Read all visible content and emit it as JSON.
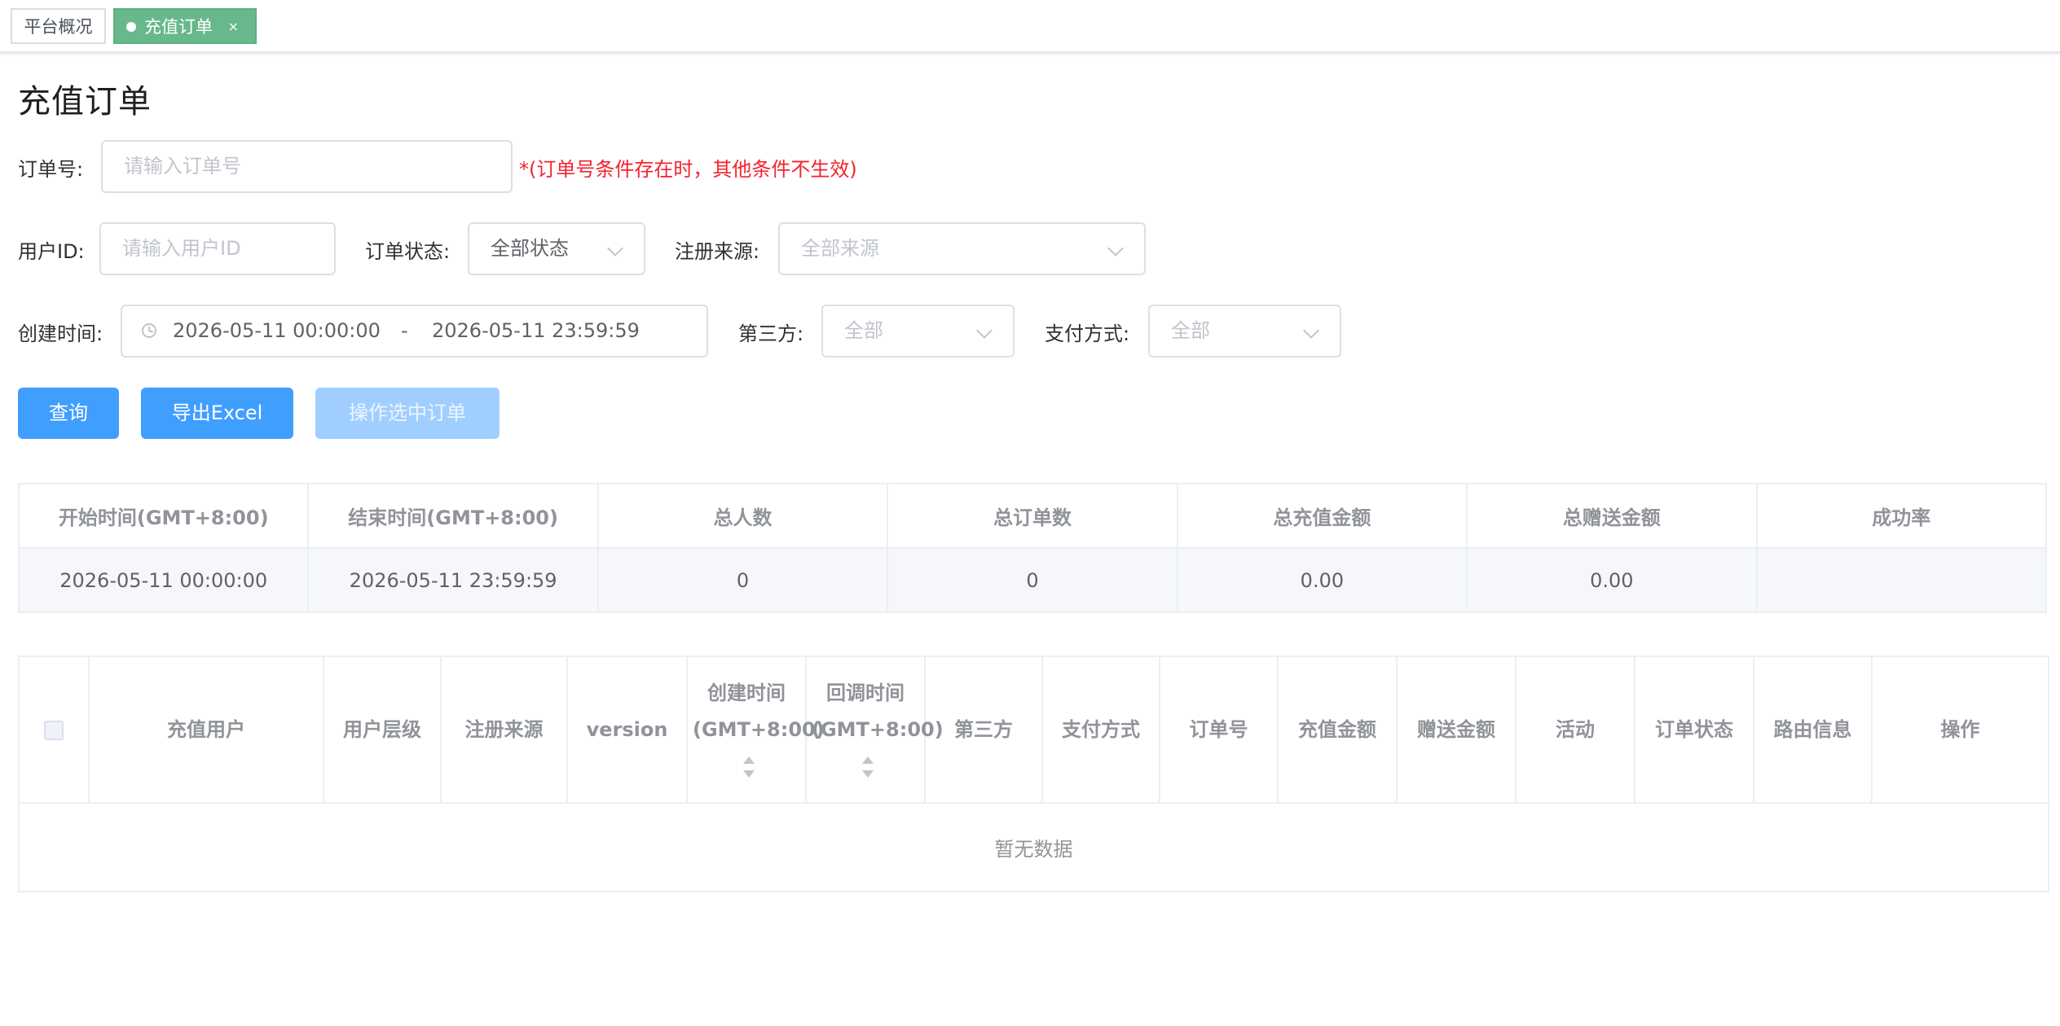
{
  "tabs": [
    {
      "label": "平台概况",
      "active": false
    },
    {
      "label": "充值订单",
      "active": true,
      "close": "×"
    }
  ],
  "page_title": "充值订单",
  "filters": {
    "order_no": {
      "label": "订单号:",
      "placeholder": "请输入订单号",
      "hint": "*(订单号条件存在时，其他条件不生效)"
    },
    "user_id": {
      "label": "用户ID:",
      "placeholder": "请输入用户ID"
    },
    "order_status": {
      "label": "订单状态:",
      "value": "全部状态"
    },
    "register_source": {
      "label": "注册来源:",
      "placeholder": "全部来源"
    },
    "created_time": {
      "label": "创建时间:",
      "start": "2026-05-11 00:00:00",
      "separator": "-",
      "end": "2026-05-11 23:59:59"
    },
    "third_party": {
      "label": "第三方:",
      "placeholder": "全部"
    },
    "pay_method": {
      "label": "支付方式:",
      "placeholder": "全部"
    }
  },
  "buttons": {
    "query": "查询",
    "export": "导出Excel",
    "operate_selected": "操作选中订单"
  },
  "summary": {
    "headers": [
      "开始时间(GMT+8:00)",
      "结束时间(GMT+8:00)",
      "总人数",
      "总订单数",
      "总充值金额",
      "总赠送金额",
      "成功率"
    ],
    "row": [
      "2026-05-11 00:00:00",
      "2026-05-11 23:59:59",
      "0",
      "0",
      "0.00",
      "0.00",
      ""
    ]
  },
  "orders_table": {
    "headers": [
      "充值用户",
      "用户层级",
      "注册来源",
      "version",
      "创建时间(GMT+8:00)",
      "回调时间(GMT+8:00)",
      "第三方",
      "支付方式",
      "订单号",
      "充值金额",
      "赠送金额",
      "活动",
      "订单状态",
      "路由信息",
      "操作"
    ],
    "empty_text": "暂无数据"
  },
  "colors": {
    "accent": "#409eff",
    "tab_active": "#67b88b",
    "hint": "#f5222d"
  }
}
